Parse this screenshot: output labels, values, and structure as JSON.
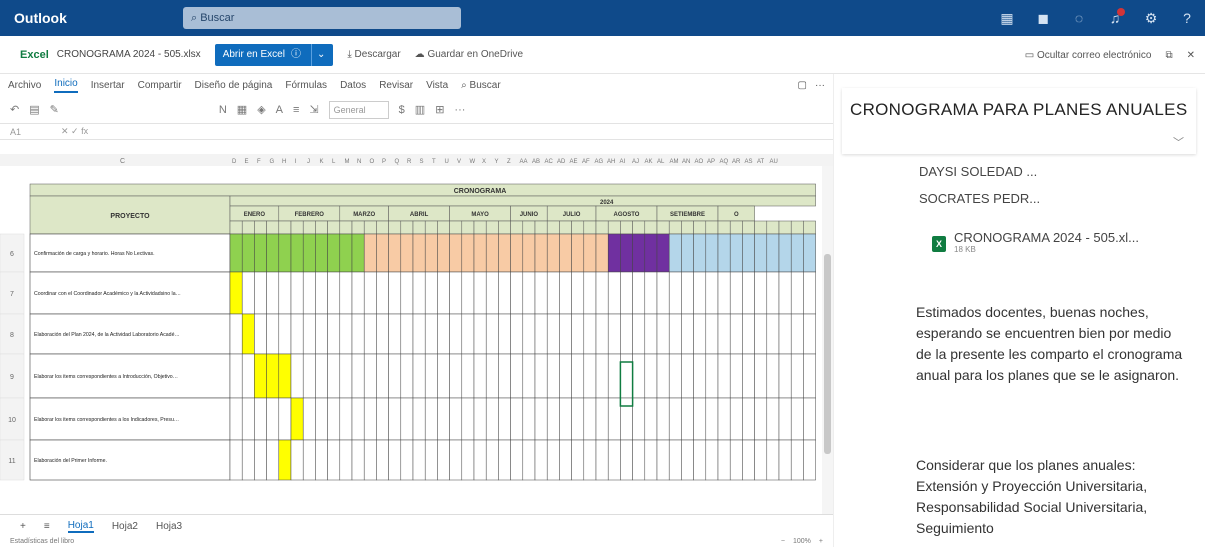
{
  "topbar": {
    "brand": "Outlook",
    "search_placeholder": "Buscar"
  },
  "docbar": {
    "app": "Excel",
    "filename": "CRONOGRAMA 2024 - 505.xlsx",
    "open_label": "Abrir en Excel",
    "download": "Descargar",
    "save_onedrive": "Guardar en OneDrive",
    "hide_email": "Ocultar correo electrónico"
  },
  "ribbon": {
    "tabs": [
      "Archivo",
      "Inicio",
      "Insertar",
      "Compartir",
      "Diseño de página",
      "Fórmulas",
      "Datos",
      "Revisar",
      "Vista"
    ],
    "search": "Buscar",
    "numfmt": "General"
  },
  "sheet": {
    "title_cronograma": "CRONOGRAMA",
    "year": "2024",
    "proyecto": "PROYECTO",
    "months": [
      "ENERO",
      "FEBRERO",
      "MARZO",
      "ABRIL",
      "MAYO",
      "JUNIO",
      "JULIO",
      "AGOSTO",
      "SETIEMBRE",
      "O"
    ],
    "col_c": "C",
    "rows": [
      {
        "num": "6",
        "text": "Confirmación de carga y horario. Horas No Lectivas."
      },
      {
        "num": "7",
        "text": "Coordinar con el Coordinador Académico y la Actividadsino las actividades a realizar en laboratorio académico."
      },
      {
        "num": "8",
        "text": "Elaboración del Plan 2024, de la Actividad Laboratorio Académico."
      },
      {
        "num": "9",
        "text": "Elaborar los items correspondientes a Introducción, Objetivos, y Plan de Actividades del Plan Anual de la Actividad Laboratorio Académico."
      },
      {
        "num": "10",
        "text": "Elaborar los items correspondientes a los Indicadores, Presupuesto y el Cronograma Anual de la Actividad Laboratorio Académico."
      },
      {
        "num": "11",
        "text": "Elaboración del Primer Informe."
      }
    ],
    "tabs": [
      "Hoja1",
      "Hoja2",
      "Hoja3"
    ],
    "status": "Estadísticas del libro",
    "zoom": "100%"
  },
  "mail": {
    "subject": "CRONOGRAMA  PARA PLANES ANUALES",
    "recipients": [
      "DAYSI SOLEDAD ...",
      "SOCRATES PEDR..."
    ],
    "attachment": {
      "name": "CRONOGRAMA 2024 - 505.xl...",
      "size": "18 KB"
    },
    "body_p1": "Estimados docentes, buenas noches, esperando se encuentren bien por medio de la presente les comparto el cronograma anual para los planes que se le asignaron.",
    "body_p2": "Considerar que los planes anuales: Extensión y Proyección Universitaria, Responsabilidad Social Universitaria, Seguimiento"
  },
  "colors": {
    "green": "#8fd14f",
    "peach": "#f8cba5",
    "purple": "#7030a0",
    "blue": "#b4d6ea",
    "yellow": "#ffff00",
    "header": "#dde7c7"
  }
}
